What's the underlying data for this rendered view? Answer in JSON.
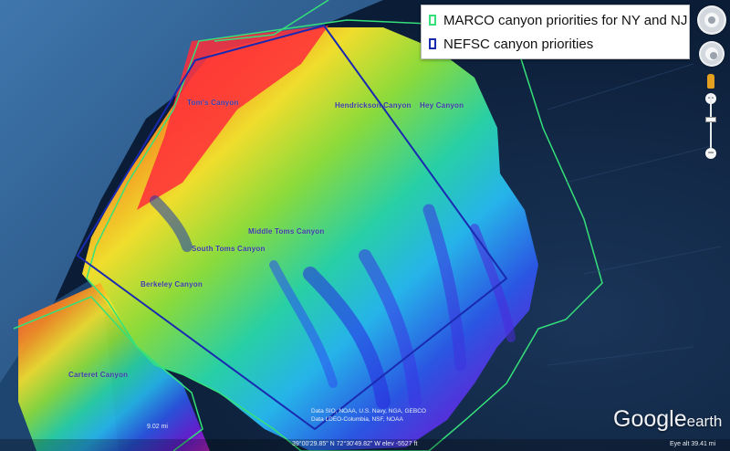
{
  "legend": {
    "items": [
      {
        "label": "MARCO canyon priorities for NY and NJ",
        "color": "#35e07a"
      },
      {
        "label": "NEFSC canyon priorities",
        "color": "#1a2ab0"
      }
    ]
  },
  "canyons": [
    {
      "name": "Tom's Canyon"
    },
    {
      "name": "Hendrickson Canyon"
    },
    {
      "name": "Hey Canyon"
    },
    {
      "name": "Middle Toms Canyon"
    },
    {
      "name": "South Toms Canyon"
    },
    {
      "name": "Berkeley Canyon"
    },
    {
      "name": "Carteret Canyon"
    }
  ],
  "attribution": {
    "line1": "Data SIO, NOAA, U.S. Navy, NGA, GEBCO",
    "line2": "Data LDEO-Columbia, NSF, NOAA"
  },
  "status": {
    "coordinates": "39°00'29.85\" N 72°30'49.82\" W elev -5527 ft",
    "eye_alt": "Eye alt   39.41 mi",
    "scale": "9.02 mi"
  },
  "branding": {
    "logo_main": "Google",
    "logo_sub": "earth"
  },
  "controls": {
    "zoom_in": "+",
    "zoom_out": "−"
  },
  "colors": {
    "ocean_deep": "#0f2747",
    "shelf": "#36679b",
    "bathy_shallow": "#ff2d2d",
    "bathy_deep": "#7a1ad6",
    "marco_outline": "#35e07a",
    "nefsc_outline": "#1a2ab0"
  }
}
